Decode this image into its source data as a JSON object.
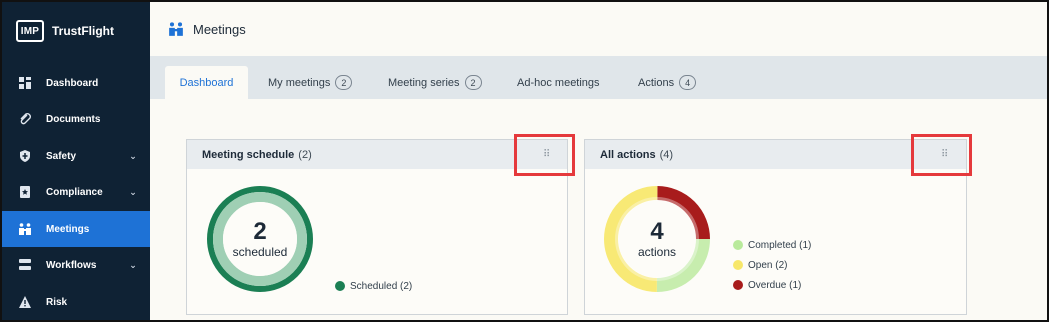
{
  "brand": {
    "logo_text": "IMP",
    "name": "TrustFlight"
  },
  "sidebar": {
    "items": [
      {
        "label": "Dashboard",
        "icon": "dashboard-icon",
        "chevron": false,
        "active": false
      },
      {
        "label": "Documents",
        "icon": "paperclip-icon",
        "chevron": true,
        "active": false
      },
      {
        "label": "Safety",
        "icon": "shield-icon",
        "chevron": true,
        "active": false
      },
      {
        "label": "Compliance",
        "icon": "star-badge-icon",
        "chevron": true,
        "active": false
      },
      {
        "label": "Meetings",
        "icon": "meetings-icon",
        "chevron": false,
        "active": true
      },
      {
        "label": "Workflows",
        "icon": "workflow-icon",
        "chevron": true,
        "active": false
      },
      {
        "label": "Risk",
        "icon": "warning-icon",
        "chevron": false,
        "active": false
      }
    ],
    "chevron_glyph": "⌄"
  },
  "header": {
    "title": "Meetings",
    "icon": "meetings-icon"
  },
  "tabs": [
    {
      "label": "Dashboard",
      "badge": null,
      "active": true
    },
    {
      "label": "My meetings",
      "badge": "2",
      "active": false
    },
    {
      "label": "Meeting series",
      "badge": "2",
      "active": false
    },
    {
      "label": "Ad-hoc meetings",
      "badge": null,
      "active": false
    },
    {
      "label": "Actions",
      "badge": "4",
      "active": false
    }
  ],
  "cards": {
    "schedule": {
      "title": "Meeting schedule",
      "count": "(2)",
      "drag_glyph": "⠿",
      "center_number": "2",
      "center_label": "scheduled",
      "legend": [
        {
          "label": "Scheduled (2)",
          "color": "#1b7f54"
        }
      ],
      "chart": {
        "type": "donut",
        "segments": [
          {
            "name": "Scheduled",
            "value": 2,
            "color": "#1b7f54"
          }
        ]
      }
    },
    "actions": {
      "title": "All actions",
      "count": "(4)",
      "drag_glyph": "⠿",
      "center_number": "4",
      "center_label": "actions",
      "legend": [
        {
          "label": "Completed (1)",
          "color": "#b9ea9c"
        },
        {
          "label": "Open (2)",
          "color": "#f7e76a"
        },
        {
          "label": "Overdue (1)",
          "color": "#a81c1c"
        }
      ],
      "chart": {
        "type": "donut",
        "segments": [
          {
            "name": "Completed",
            "value": 1,
            "color": "#c7edae"
          },
          {
            "name": "Open",
            "value": 2,
            "color": "#f8e975"
          },
          {
            "name": "Overdue",
            "value": 1,
            "color": "#a81c1c"
          }
        ]
      }
    }
  },
  "colors": {
    "sidebar_bg": "#0f2234",
    "accent": "#1e72d6",
    "highlight": "#e5393c"
  }
}
